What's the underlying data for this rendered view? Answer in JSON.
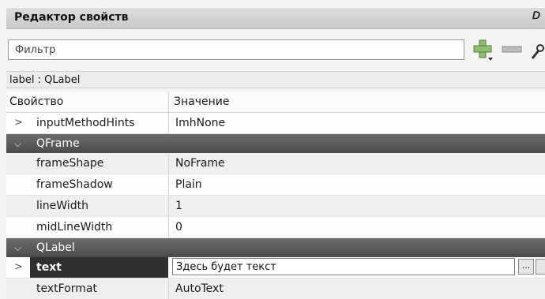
{
  "window": {
    "title": "Редактор свойств"
  },
  "filter": {
    "placeholder": "Фильтр"
  },
  "object": {
    "label": "label : QLabel"
  },
  "table": {
    "headers": {
      "property": "Свойство",
      "value": "Значение"
    },
    "rows_top": [
      {
        "name": "inputMethodHints",
        "value": "ImhNone"
      }
    ],
    "group_qframe": "QFrame",
    "rows_qframe": [
      {
        "name": "frameShape",
        "value": "NoFrame"
      },
      {
        "name": "frameShadow",
        "value": "Plain"
      },
      {
        "name": "lineWidth",
        "value": "1"
      },
      {
        "name": "midLineWidth",
        "value": "0"
      }
    ],
    "group_qlabel": "QLabel",
    "rows_qlabel": [
      {
        "name": "text",
        "value": "Здесь будет текст"
      },
      {
        "name": "textFormat",
        "value": "AutoText"
      }
    ],
    "editor_dots": "..."
  },
  "colors": {
    "group_header": "#4b4b4b",
    "selected_cell": "#2f2f2f",
    "plus_icon": "#6aa84f",
    "minus_icon": "#888888"
  }
}
